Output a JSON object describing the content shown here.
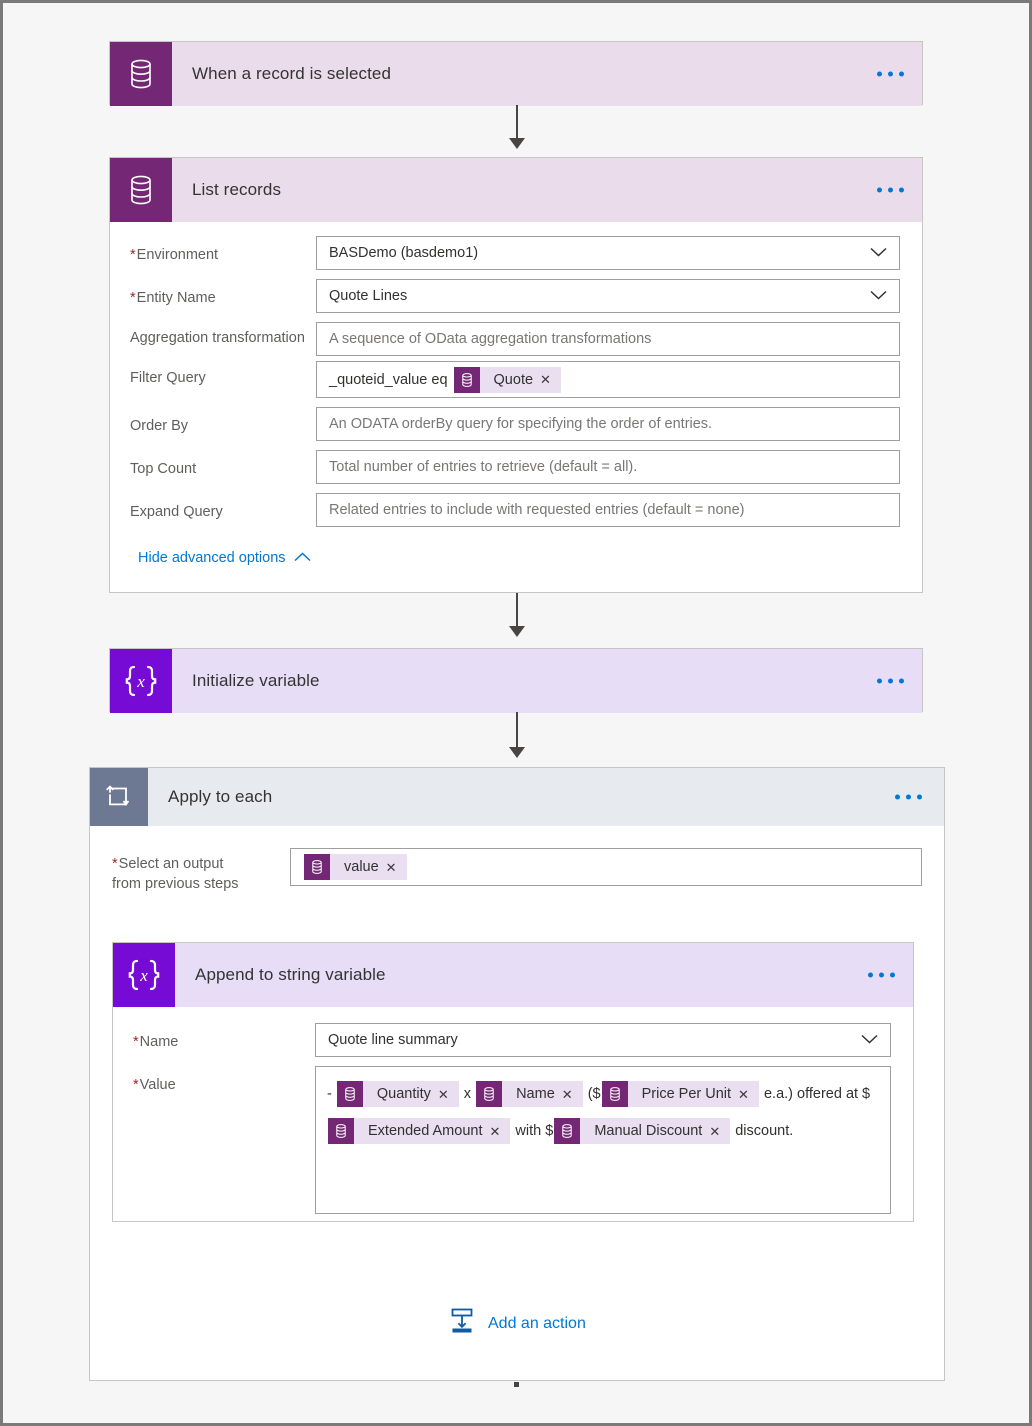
{
  "app": {
    "canvas_bg": "#f6f6f6",
    "accent_blue": "#0078d4",
    "dataverse_purple": "#742774",
    "variable_purple": "#770bd6",
    "loop_gray": "#6d7993"
  },
  "steps": [
    {
      "id": "trigger",
      "title": "When a record is selected",
      "icon": "dataverse-database-icon",
      "menu": "more-commands-ellipsis"
    },
    {
      "id": "list-records",
      "title": "List records",
      "icon": "dataverse-database-icon",
      "menu": "more-commands-ellipsis",
      "fields": [
        {
          "label": "Environment",
          "required": true,
          "value": "BASDemo (basdemo1)",
          "placeholder": "",
          "dropdown": true
        },
        {
          "label": "Entity Name",
          "required": true,
          "value": "Quote Lines",
          "placeholder": "",
          "dropdown": true
        },
        {
          "label": "Aggregation transformation",
          "required": false,
          "value": "",
          "placeholder": "A sequence of OData aggregation transformations",
          "dropdown": false
        },
        {
          "label": "Filter Query",
          "required": false,
          "value": "_quoteid_value eq",
          "placeholder": "",
          "dropdown": false,
          "token": "Quote"
        },
        {
          "label": "Order By",
          "required": false,
          "value": "",
          "placeholder": "An ODATA orderBy query for specifying the order of entries.",
          "dropdown": false
        },
        {
          "label": "Top Count",
          "required": false,
          "value": "",
          "placeholder": "Total number of entries to retrieve (default = all).",
          "dropdown": false
        },
        {
          "label": "Expand Query",
          "required": false,
          "value": "",
          "placeholder": "Related entries to include with requested entries (default = none)",
          "dropdown": false
        }
      ],
      "advanced_link": "Hide advanced options",
      "advanced_chevron": "chevron-up-icon"
    },
    {
      "id": "initialize-variable",
      "title": "Initialize variable",
      "icon": "variable-braces-icon",
      "menu": "more-commands-ellipsis"
    },
    {
      "id": "apply-to-each",
      "title": "Apply to each",
      "icon": "loop-repeat-icon",
      "menu": "more-commands-ellipsis",
      "select_output": {
        "label_line1": "Select an output",
        "label_line2": "from previous steps",
        "required": true,
        "token": "value"
      }
    },
    {
      "id": "append-to-string-variable",
      "title": "Append to string variable",
      "icon": "variable-braces-icon",
      "menu": "more-commands-ellipsis",
      "name_field": {
        "label": "Name",
        "required": true,
        "value": "Quote line summary",
        "dropdown": true
      },
      "value_field": {
        "label": "Value",
        "required": true,
        "parts": [
          {
            "type": "text",
            "text": "- "
          },
          {
            "type": "token",
            "label": "Quantity"
          },
          {
            "type": "text",
            "text": " x "
          },
          {
            "type": "token",
            "label": "Name"
          },
          {
            "type": "text",
            "text": " ($"
          },
          {
            "type": "token",
            "label": "Price Per Unit"
          },
          {
            "type": "text",
            "text": " e.a.) "
          },
          {
            "type": "text",
            "text": "offered at $"
          },
          {
            "type": "token",
            "label": "Extended Amount"
          },
          {
            "type": "text",
            "text": " with $"
          },
          {
            "type": "token",
            "label": "Manual Discount"
          },
          {
            "type": "text",
            "text": " discount."
          }
        ]
      }
    }
  ],
  "add_action": {
    "label": "Add an action",
    "icon": "insert-below-icon"
  }
}
